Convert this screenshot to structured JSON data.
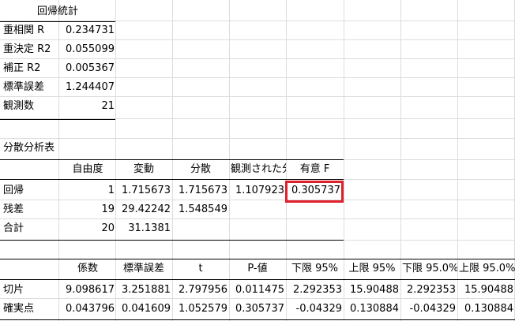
{
  "regression_stats": {
    "header": "回帰統計",
    "rows": [
      {
        "label": "重相関 R",
        "value": "0.234731"
      },
      {
        "label": "重決定 R2",
        "value": "0.055099"
      },
      {
        "label": "補正 R2",
        "value": "0.005367"
      },
      {
        "label": "標準誤差",
        "value": "1.244407"
      },
      {
        "label": "観測数",
        "value": "21"
      }
    ]
  },
  "anova": {
    "title": "分散分析表",
    "headers": [
      "",
      "自由度",
      "変動",
      "分散",
      "観測された分散比",
      "有意 F"
    ],
    "rows": [
      [
        "回帰",
        "1",
        "1.715673",
        "1.715673",
        "1.107923",
        "0.305737"
      ],
      [
        "残差",
        "19",
        "29.42242",
        "1.548549",
        "",
        ""
      ],
      [
        "合計",
        "20",
        "31.1381",
        "",
        "",
        ""
      ]
    ],
    "highlight_color": "#e0202a"
  },
  "coefficients": {
    "headers": [
      "",
      "係数",
      "標準誤差",
      "t",
      "P-値",
      "下限 95%",
      "上限 95%",
      "下限 95.0%",
      "上限 95.0%"
    ],
    "rows": [
      [
        "切片",
        "9.098617",
        "3.251881",
        "2.797956",
        "0.011475",
        "2.292353",
        "15.90488",
        "2.292353",
        "15.90488"
      ],
      [
        "確実点",
        "0.043796",
        "0.041609",
        "1.052579",
        "0.305737",
        "-0.04329",
        "0.130884",
        "-0.04329",
        "0.130884"
      ]
    ]
  }
}
